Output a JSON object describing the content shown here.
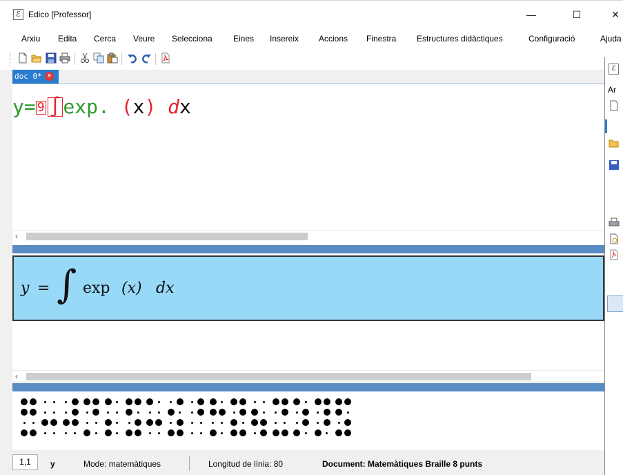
{
  "window": {
    "app_icon_glyph": "ℰ",
    "title": "Edico  [Professor]",
    "minimize": "—",
    "maximize": "☐",
    "close": "✕"
  },
  "menu": [
    "Arxiu",
    "Edita",
    "Cerca",
    "Veure",
    "Selecciona",
    "Eines",
    "Insereix",
    "Accions",
    "Finestra",
    "Estructures didàctiques",
    "Configuració",
    "Ajuda"
  ],
  "toolbar": {
    "icons": [
      "new-document-icon",
      "open-folder-icon",
      "save-icon",
      "print-icon",
      "cut-icon",
      "copy-icon",
      "paste-icon",
      "undo-icon",
      "redo-icon",
      "pdf-icon"
    ]
  },
  "tab": {
    "label": "doc 0*",
    "close_glyph": "×"
  },
  "editor": {
    "tokens": [
      {
        "text": "y",
        "style": "green"
      },
      {
        "text": "=",
        "style": "green"
      },
      {
        "text": "9",
        "style": "small-boxed"
      },
      {
        "text": "∫",
        "style": "boxed"
      },
      {
        "text": "exp",
        "style": "green"
      },
      {
        "text": ".",
        "style": "green"
      },
      {
        "text": " ",
        "style": "green"
      },
      {
        "text": "(",
        "style": "red"
      },
      {
        "text": "x",
        "style": "black"
      },
      {
        "text": ")",
        "style": "red"
      },
      {
        "text": " ",
        "style": "green"
      },
      {
        "text": "d",
        "style": "red-italic"
      },
      {
        "text": "x",
        "style": "black"
      }
    ],
    "scroll_left": "‹"
  },
  "preview": {
    "parts": [
      "y",
      "=",
      "∫",
      "exp",
      "(x)",
      "dx"
    ]
  },
  "preview_scroll_left": "‹",
  "braille": {
    "cells": [
      [
        1,
        2,
        4,
        5,
        7,
        8
      ],
      [
        3,
        6
      ],
      [
        3,
        4,
        5,
        6
      ],
      [
        1,
        4,
        5,
        7
      ],
      [
        1,
        3,
        7
      ],
      [
        1,
        2,
        4,
        6,
        7,
        8
      ],
      [
        1,
        3,
        6
      ],
      [
        2,
        4,
        6,
        7,
        8
      ],
      [
        4,
        5
      ],
      [
        1,
        2,
        5,
        7
      ],
      [
        1,
        3,
        4,
        5,
        7,
        8
      ],
      [
        2,
        3,
        6,
        8
      ],
      [
        1,
        4,
        5,
        7,
        8
      ],
      [
        1,
        5,
        6,
        7
      ],
      [
        1,
        4,
        5,
        6,
        7
      ],
      [
        1,
        2,
        4,
        6,
        7,
        8
      ]
    ]
  },
  "status": {
    "position": "1,1",
    "char": "y",
    "mode": "Mode: matemàtiques",
    "line_length": "Longitud de línia: 80",
    "document": "Document: Matemàtiques  Braille 8 punts"
  },
  "background_window": {
    "title_glyph": "ℰ",
    "menu_fragment": "Ar"
  },
  "colors": {
    "tab_blue": "#2a7ccf",
    "formula_bg": "#97d9f7",
    "splitter": "#5a8cc4",
    "token_green": "#2c9a2c",
    "token_red": "#e3242b"
  }
}
